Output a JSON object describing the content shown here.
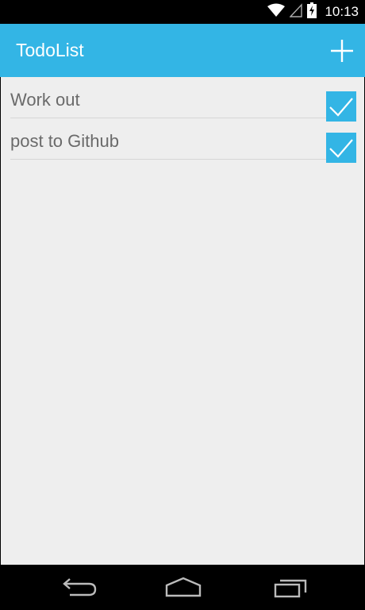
{
  "status_bar": {
    "time": "10:13",
    "icons": [
      "wifi-icon",
      "signal-icon",
      "battery-charging-icon"
    ]
  },
  "action_bar": {
    "title": "TodoList",
    "add_icon": "plus-icon",
    "color": "#33b5e5"
  },
  "todos": [
    {
      "label": "Work out",
      "checked": true
    },
    {
      "label": "post to Github",
      "checked": true
    }
  ],
  "nav_bar": {
    "buttons": [
      "back-icon",
      "home-icon",
      "recent-apps-icon"
    ]
  },
  "colors": {
    "accent": "#33b5e5",
    "background": "#eeeeee",
    "text": "#6a6a6a"
  }
}
